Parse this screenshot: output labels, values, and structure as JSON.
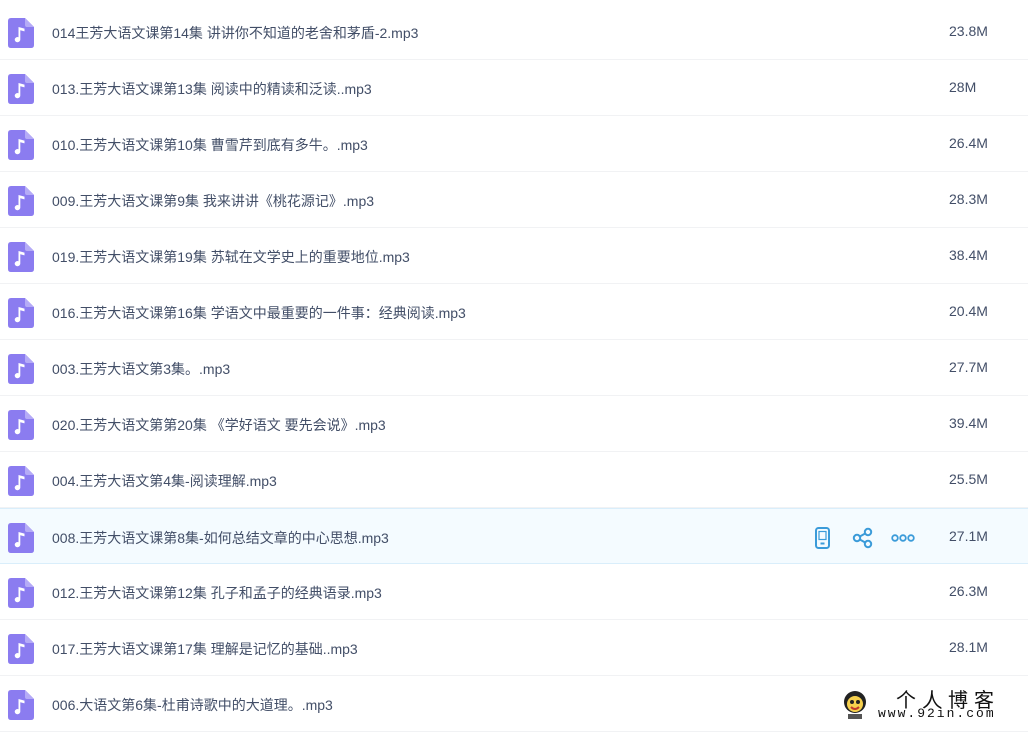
{
  "files": [
    {
      "name": "014王芳大语文课第14集 讲讲你不知道的老舍和茅盾-2.mp3",
      "size": "23.8M"
    },
    {
      "name": "013.王芳大语文课第13集 阅读中的精读和泛读..mp3",
      "size": "28M"
    },
    {
      "name": "010.王芳大语文课第10集 曹雪芹到底有多牛。.mp3",
      "size": "26.4M"
    },
    {
      "name": "009.王芳大语文课第9集 我来讲讲《桃花源记》.mp3",
      "size": "28.3M"
    },
    {
      "name": "019.王芳大语文课第19集 苏轼在文学史上的重要地位.mp3",
      "size": "38.4M"
    },
    {
      "name": "016.王芳大语文课第16集 学语文中最重要的一件事：经典阅读.mp3",
      "size": "20.4M"
    },
    {
      "name": "003.王芳大语文第3集。.mp3",
      "size": "27.7M"
    },
    {
      "name": "020.王芳大语文第第20集 《学好语文 要先会说》.mp3",
      "size": "39.4M"
    },
    {
      "name": "004.王芳大语文第4集-阅读理解.mp3",
      "size": "25.5M"
    },
    {
      "name": "008.王芳大语文课第8集-如何总结文章的中心思想.mp3",
      "size": "27.1M"
    },
    {
      "name": "012.王芳大语文课第12集 孔子和孟子的经典语录.mp3",
      "size": "26.3M"
    },
    {
      "name": "017.王芳大语文课第17集 理解是记忆的基础..mp3",
      "size": "28.1M"
    },
    {
      "name": "006.大语文第6集-杜甫诗歌中的大道理。.mp3",
      "size": ""
    }
  ],
  "hover_index": 9,
  "icons": {
    "file": "music-file-icon",
    "actions": [
      "phone-icon",
      "share-icon",
      "more-icon"
    ]
  },
  "colors": {
    "file_icon": "#8b7cf0",
    "accent": "#3b9bd9",
    "text": "#424e67"
  },
  "watermark": {
    "title": "个人博客",
    "url": "www.92in.com"
  }
}
